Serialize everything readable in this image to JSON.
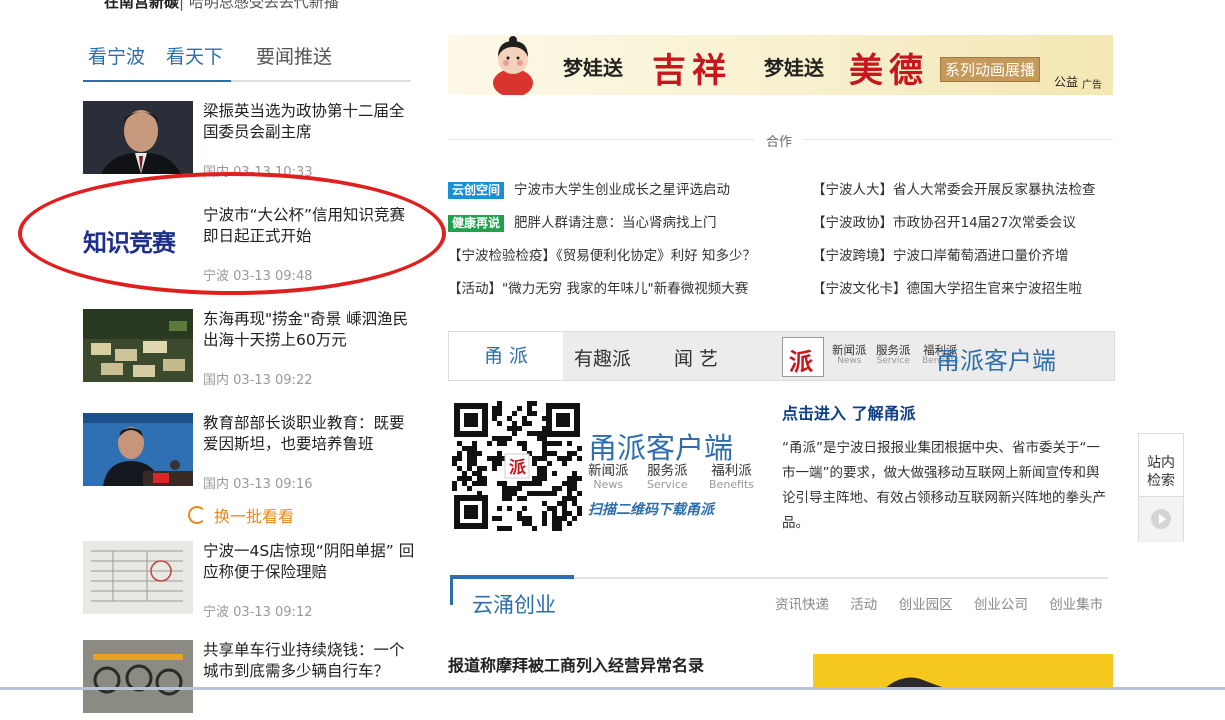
{
  "top_cut": {
    "bold": "在南宫新碳",
    "rest": "| 哈明总感受丢丢代新播"
  },
  "left_tabs": [
    "看宁波",
    "看天下",
    "要闻推送"
  ],
  "news": [
    {
      "title": "梁振英当选为政协第十二届全国委员会副主席",
      "meta": "国内 03-13 10:33"
    },
    {
      "title": "宁波市“大公杯”信用知识竞赛即日起正式开始",
      "meta": "宁波 03-13 09:48",
      "thumb_text": "知识竞赛"
    },
    {
      "title": "东海再现\"捞金\"奇景 嵊泗渔民出海十天捞上60万元",
      "meta": "国内 03-13 09:22"
    },
    {
      "title": "教育部部长谈职业教育：既要爱因斯坦，也要培养鲁班",
      "meta": "国内 03-13 09:16"
    },
    {
      "title": "宁波一4S店惊现“阴阳单据” 回应称便于保险理赔",
      "meta": "宁波 03-13 09:12"
    },
    {
      "title": "共享单车行业持续烧钱：一个城市到底需多少辆自行车？",
      "meta": ""
    }
  ],
  "refresh_label": "换一批看看",
  "banner": {
    "text1": "梦娃送",
    "big1": "吉祥",
    "text2": "梦娃送",
    "big2": "美德",
    "series": "系列动画展播",
    "public": "公益",
    "ad": "广告"
  },
  "coop": {
    "label": "合作",
    "items": [
      {
        "badge": "云创空间",
        "badge_color": "#1a8fd6",
        "text": "宁波市大学生创业成长之星评选启动"
      },
      {
        "text": "【宁波人大】省人大常委会开展反家暴执法检查"
      },
      {
        "badge": "健康再说",
        "badge_color": "#1ea34a",
        "text": "肥胖人群请注意：当心肾病找上门"
      },
      {
        "text": "【宁波政协】市政协召开14届27次常委会议"
      },
      {
        "text": "【宁波检验检疫】《贸易便利化协定》利好 知多少？"
      },
      {
        "text": "【宁波跨境】宁波口岸葡萄酒进口量价齐增"
      },
      {
        "text": "【活动】\"微力无穷 我家的年味儿\"新春微视频大赛"
      },
      {
        "text": "【宁波文化卡】德国大学招生官来宁波招生啦"
      }
    ]
  },
  "yongpai": {
    "tabs": [
      "甬 派",
      "有趣派",
      "闻 艺"
    ],
    "logo_char": "派",
    "subs": [
      {
        "cn": "新闻派",
        "en": "News"
      },
      {
        "cn": "服务派",
        "en": "Service"
      },
      {
        "cn": "福利派",
        "en": "Benefits"
      }
    ],
    "client": "甬派客户端",
    "qr_client": "甬派客户端",
    "qr_scan": "扫描二维码下载甬派",
    "qr_logo": "派",
    "click_link": "点击进入 了解甬派",
    "desc": "“甬派”是宁波日报报业集团根据中央、省市委关于“一市一端”的要求，做大做强移动互联网上新闻宣传和舆论引导主阵地、有效占领移动互联网新兴阵地的拳头产品。"
  },
  "side_float": {
    "label": "站内检索"
  },
  "yuncong": {
    "title": "云涌创业",
    "links": [
      "资讯快递",
      "活动",
      "创业园区",
      "创业公司",
      "创业集市"
    ],
    "headline": "报道称摩拜被工商列入经营异常名录"
  }
}
